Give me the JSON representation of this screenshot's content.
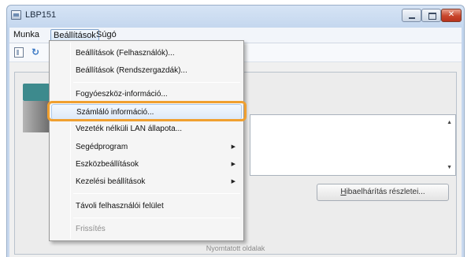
{
  "window": {
    "title": "LBP151"
  },
  "menubar": {
    "items": [
      "Munka",
      "Beállítások",
      "Súgó"
    ]
  },
  "dropdown": {
    "items": [
      {
        "label": "Beállítások (Felhasználók)...",
        "submenu": false,
        "disabled": false
      },
      {
        "label": "Beállítások (Rendszergazdák)...",
        "submenu": false,
        "disabled": false
      },
      {
        "label": "Fogyóeszköz-információ...",
        "submenu": false,
        "disabled": false
      },
      {
        "label": "Számláló információ...",
        "submenu": false,
        "disabled": false,
        "highlighted": true
      },
      {
        "label": "Vezeték nélküli LAN állapota...",
        "submenu": false,
        "disabled": false
      },
      {
        "label": "Segédprogram",
        "submenu": true,
        "disabled": false
      },
      {
        "label": "Eszközbeállítások",
        "submenu": true,
        "disabled": false
      },
      {
        "label": "Kezelési beállítások",
        "submenu": true,
        "disabled": false
      },
      {
        "label": "Távoli felhasználói felület",
        "submenu": false,
        "disabled": false
      },
      {
        "label": "Frissítés",
        "submenu": false,
        "disabled": true
      }
    ]
  },
  "main": {
    "error_button": {
      "hotkey": "H",
      "rest": "ibaelhárítás részletei..."
    },
    "bottom_text": "Nyomtatott oldalak"
  },
  "colors": {
    "highlight_ring": "#f0a030",
    "title_gradient": "#c3d6ee",
    "close_button": "#c8452b"
  }
}
